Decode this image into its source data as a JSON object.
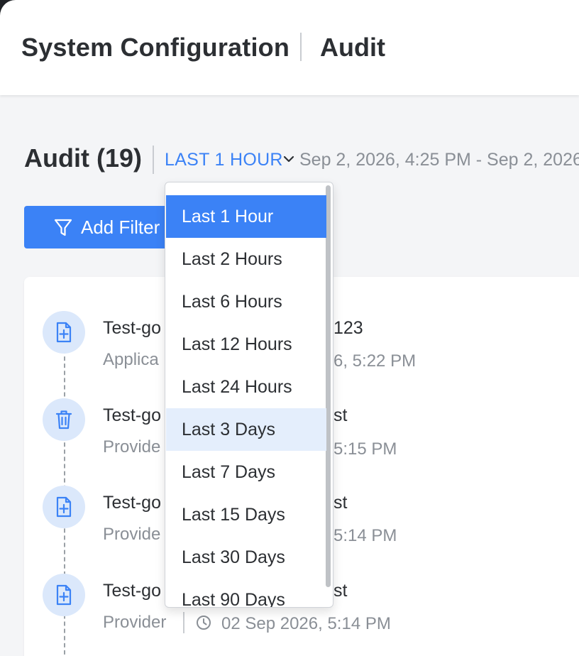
{
  "header": {
    "crumb_section": "System Configuration",
    "crumb_page": "Audit"
  },
  "audit": {
    "title": "Audit (19)",
    "range_label": "LAST 1 HOUR",
    "range_text": "Sep 2, 2026, 4:25 PM - Sep 2, 2026,"
  },
  "toolbar": {
    "add_filter_label": "Add Filter"
  },
  "entries": [
    {
      "icon": "file-add-icon",
      "name_head": "Test-go",
      "name_tail": "123",
      "type": "Applica",
      "time": "6, 5:22 PM"
    },
    {
      "icon": "trash-icon",
      "name_head": "Test-go",
      "name_tail": "st",
      "type": "Provide",
      "time": "5:15 PM"
    },
    {
      "icon": "file-add-icon",
      "name_head": "Test-go",
      "name_tail": "st",
      "type": "Provide",
      "time": "5:14 PM"
    },
    {
      "icon": "file-add-icon",
      "name_head": "Test-go",
      "name_tail": "st",
      "type": "Provider",
      "time": "02 Sep 2026, 5:14 PM"
    }
  ],
  "range_dropdown": {
    "options": [
      "Last 1 Hour",
      "Last 2 Hours",
      "Last 6 Hours",
      "Last 12 Hours",
      "Last 24 Hours",
      "Last 3 Days",
      "Last 7 Days",
      "Last 15 Days",
      "Last 30 Days",
      "Last 90 Days"
    ],
    "selected": "Last 1 Hour",
    "hovered": "Last 3 Days"
  },
  "colors": {
    "accent": "#3b82f6",
    "icon_bg": "#dbe8fb",
    "muted_text": "#8a8f96",
    "hover_bg": "#e4eefc"
  }
}
